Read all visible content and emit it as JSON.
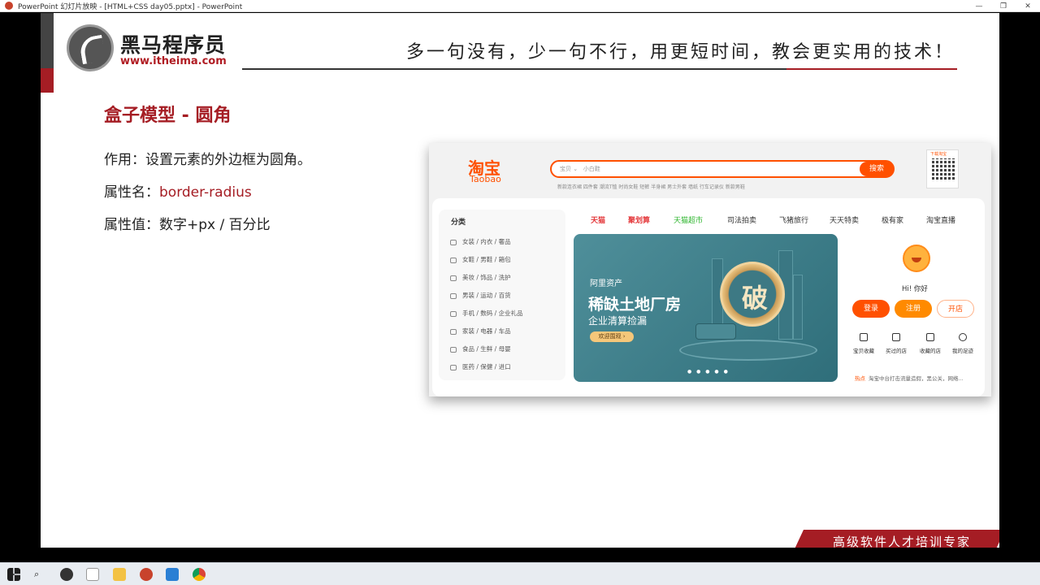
{
  "window": {
    "title": "PowerPoint 幻灯片放映 - [HTML+CSS day05.pptx] - PowerPoint",
    "controls": [
      "—",
      "❐",
      "✕"
    ]
  },
  "slide": {
    "logo_cn": "黑马程序员",
    "logo_url": "www.itheima.com",
    "slogan": "多一句没有，少一句不行，用更短时间，教会更实用的技术！",
    "title": "盒子模型 - 圆角",
    "lines": [
      {
        "label": "作用：",
        "value": "设置元素的外边框为圆角。"
      },
      {
        "label": "属性名：",
        "value": "border-radius"
      },
      {
        "label": "属性值：",
        "value": "数字+px / 百分比"
      }
    ],
    "footer_banner": "高级软件人才培训专家"
  },
  "taobao": {
    "logo": "淘宝",
    "logo_en": "Taobao",
    "search_tag": "宝贝",
    "search_placeholder": "小白鞋",
    "search_button": "搜索",
    "hot_words": "新款连衣裙  四件套  潮流T恤  时尚女鞋  短裤  半身裙  男士外套  墙纸  行车记录仪  新款男鞋",
    "qr_label": "下载淘宝",
    "category_title": "分类",
    "categories": [
      "女装 / 内衣 / 奢品",
      "女鞋 / 男鞋 / 箱包",
      "美妆 / 饰品 / 洗护",
      "男装 / 运动 / 百货",
      "手机 / 数码 / 企业礼品",
      "家装 / 电器 / 车品",
      "食品 / 生鲜 / 母婴",
      "医药 / 保健 / 进口"
    ],
    "nav": [
      "天猫",
      "聚划算",
      "天猫超市",
      "司法拍卖",
      "飞猪旅行",
      "天天特卖",
      "极有家",
      "淘宝直播"
    ],
    "nav_colors": [
      "#e4393c",
      "#e4393c",
      "#2fb62f",
      "#333333",
      "#333333",
      "#333333",
      "#333333",
      "#333333"
    ],
    "banner": {
      "brand": "阿里资产",
      "headline": "稀缺土地厂房",
      "sub": "企业清算捡漏",
      "button": "欢迎围观 ›",
      "coin_char": "破",
      "dots": "● ● ● ● ●"
    },
    "greeting": "Hi! 你好",
    "buttons": [
      "登录",
      "注册",
      "开店"
    ],
    "services": [
      "宝贝收藏",
      "买过的店",
      "收藏的店",
      "我的足迹"
    ],
    "news_tag": "热点",
    "news_text": "淘宝中台打击流量造假，黑公关，网络..."
  },
  "accent_color": "#a51d24",
  "taobao_orange": "#ff5000"
}
